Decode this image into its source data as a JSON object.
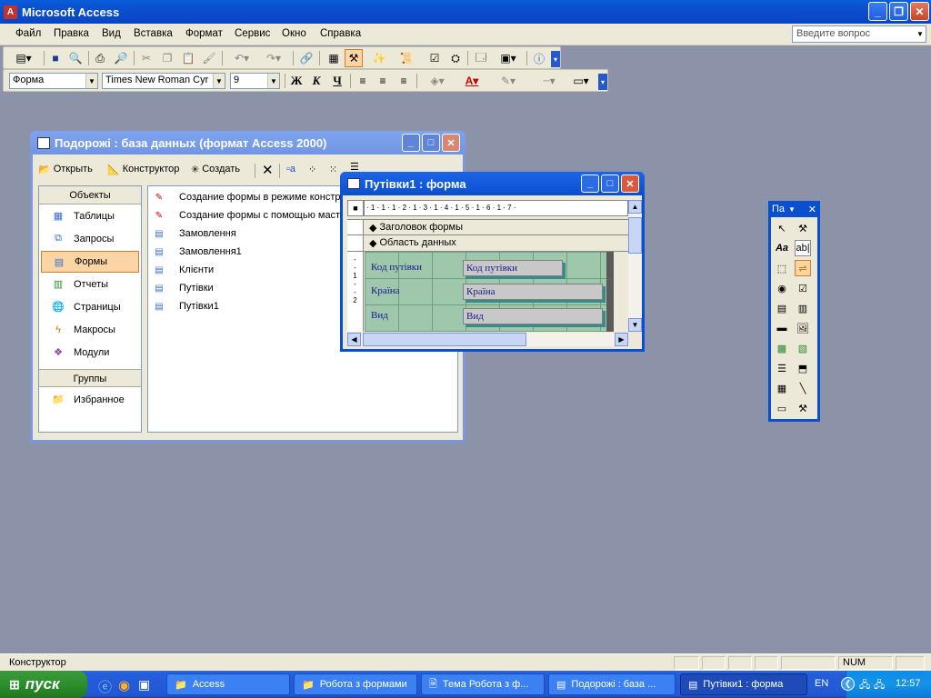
{
  "app": {
    "title": "Microsoft Access"
  },
  "menu": {
    "items": [
      "Файл",
      "Правка",
      "Вид",
      "Вставка",
      "Формат",
      "Сервис",
      "Окно",
      "Справка"
    ]
  },
  "help_box": {
    "placeholder": "Введите вопрос"
  },
  "format_toolbar": {
    "object": "Форма",
    "font": "Times New Roman Cyr",
    "size": "9",
    "bold": "Ж",
    "italic": "К",
    "underline": "Ч"
  },
  "db_window": {
    "title": "Подорожі : база данных (формат Access 2000)",
    "toolbar": {
      "open": "Открыть",
      "design": "Конструктор",
      "create": "Создать"
    },
    "objects_header": "Объекты",
    "objects": [
      "Таблицы",
      "Запросы",
      "Формы",
      "Отчеты",
      "Страницы",
      "Макросы",
      "Модули"
    ],
    "groups_header": "Группы",
    "groups": [
      "Избранное"
    ],
    "list": [
      "Создание формы в режиме констру",
      "Создание формы с помощью мастер",
      "Замовлення",
      "Замовлення1",
      "Клієнти",
      "Путівки",
      "Путівки1"
    ]
  },
  "form_window": {
    "title": "Путівки1 : форма",
    "ruler": "· 1 · 1 · 1 · 2 · 1 · 3 · 1 · 4 · 1 · 5 · 1 · 6 · 1 · 7 ·",
    "sections": [
      "Заголовок формы",
      "Область данных"
    ],
    "labels": [
      "Код путівки",
      "Країна",
      "Вид"
    ],
    "fields": [
      "Код путівки",
      "Країна",
      "Вид"
    ],
    "vruler": [
      "1",
      "2"
    ]
  },
  "toolbox": {
    "title": "Па"
  },
  "status": {
    "text": "Конструктор",
    "num": "NUM"
  },
  "taskbar": {
    "start": "пуск",
    "tasks": [
      "Access",
      "Робота з формами",
      "Тема Робота з ф...",
      "Подорожі : база ...",
      "Путівки1 : форма"
    ],
    "lang": "EN",
    "clock": "12:57"
  },
  "colors": {
    "xp_blue": "#0a4fcf",
    "desktop": "#8c93a8",
    "selected_tab": "#fbd6a4"
  }
}
